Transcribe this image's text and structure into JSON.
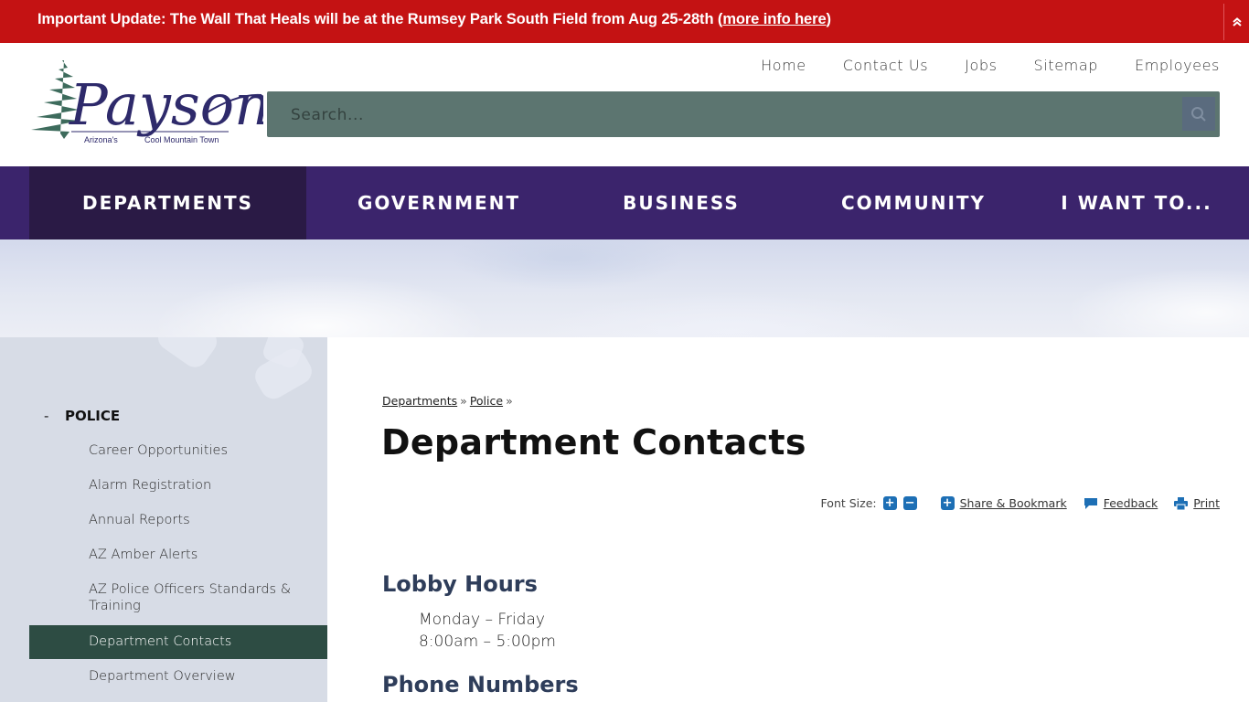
{
  "alert": {
    "message": "Important Update: The Wall That Heals will be at the Rumsey Park South Field from Aug 25-28th (",
    "link_label": "more info here",
    "suffix": ")",
    "toggle_icon": "double-chevron-up-icon"
  },
  "logo": {
    "name": "Payson",
    "tagline_left": "Arizona's",
    "tagline_right": "Cool Mountain Town"
  },
  "utility_nav": [
    {
      "label": "Home"
    },
    {
      "label": "Contact Us"
    },
    {
      "label": "Jobs"
    },
    {
      "label": "Sitemap"
    },
    {
      "label": "Employees"
    }
  ],
  "search": {
    "placeholder": "Search...",
    "value": "",
    "button_icon": "search-icon"
  },
  "main_nav": [
    {
      "label": "DEPARTMENTS",
      "active": true
    },
    {
      "label": "GOVERNMENT",
      "active": false
    },
    {
      "label": "BUSINESS",
      "active": false
    },
    {
      "label": "COMMUNITY",
      "active": false
    },
    {
      "label": "I WANT TO...",
      "active": false
    }
  ],
  "sidebar": {
    "parent": {
      "toggle": "-",
      "label": "POLICE"
    },
    "items": [
      {
        "label": "Career Opportunities",
        "active": false
      },
      {
        "label": "Alarm Registration",
        "active": false
      },
      {
        "label": "Annual Reports",
        "active": false
      },
      {
        "label": "AZ Amber Alerts",
        "active": false
      },
      {
        "label": "AZ Police Officers Standards & Training",
        "active": false
      },
      {
        "label": "Department Contacts",
        "active": true
      },
      {
        "label": "Department Overview",
        "active": false
      }
    ]
  },
  "breadcrumb": {
    "items": [
      "Departments",
      "Police"
    ],
    "separator": "»"
  },
  "page": {
    "title": "Department Contacts",
    "tools": {
      "font_size_label": "Font Size:",
      "increase": "+",
      "decrease": "−",
      "share_label": "Share & Bookmark",
      "feedback_label": "Feedback",
      "print_label": "Print"
    },
    "sections": [
      {
        "heading": "Lobby Hours",
        "lines": [
          "Monday – Friday",
          "8:00am – 5:00pm"
        ]
      },
      {
        "heading": "Phone Numbers",
        "lines": []
      }
    ]
  },
  "colors": {
    "alert_bg": "#c41213",
    "nav_bg": "#3b246c",
    "nav_active": "#2a1a45",
    "search_bg": "#5c7570",
    "sidebar_active": "#2d4c43",
    "heading": "#2e3d5a",
    "tool_icon": "#1d6fb5"
  }
}
